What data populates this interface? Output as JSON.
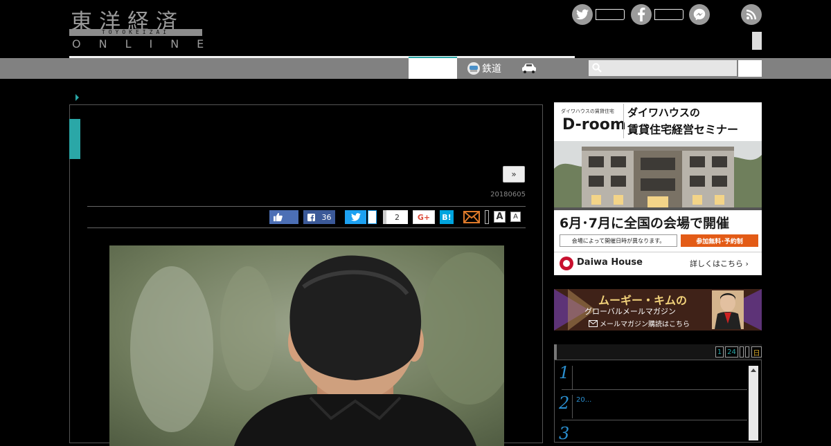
{
  "logo": {
    "kanji": "東洋経済",
    "romaji": "TOYOKEIZAI",
    "online": "ONLINE"
  },
  "header": {
    "social": [
      "twitter-icon",
      "facebook-icon",
      "messenger-icon",
      "rss-icon"
    ]
  },
  "nav": {
    "tetsudo_label": "鉄道",
    "search": {
      "placeholder": ""
    }
  },
  "article": {
    "next_button": "»",
    "date": "20180605",
    "share": {
      "facebook_count": "36",
      "pocket_count": "2",
      "gplus_label": "G+",
      "hatena_label": "B!",
      "font_large": "A",
      "font_small": "A"
    }
  },
  "sidebar": {
    "ad1": {
      "tagline": "ダイワハウスの賃貸住宅",
      "brand": "D-room",
      "headline_1": "ダイワハウスの",
      "headline_2": "賃貸住宅経営セミナー",
      "banner": "6月･7月に全国の会場で開催",
      "note": "会場によって開催日時が異なります。",
      "cta": "参加無料･予約制",
      "company": "Daiwa House",
      "more": "詳しくはこちら ›"
    },
    "ad2": {
      "title": "ムーギー・キムの",
      "subtitle": "グローバルメールマガジン",
      "cta": "メールマガジン購読はこちら"
    },
    "ranking": {
      "tabs": [
        "1",
        "24",
        "",
        "",
        "日"
      ],
      "items": [
        {
          "rank": "1",
          "text": ""
        },
        {
          "rank": "2",
          "text": "20..."
        },
        {
          "rank": "3",
          "text": ""
        }
      ]
    }
  },
  "colors": {
    "accent": "#2aa7a7",
    "nav_gray": "#818181",
    "background": "#000000"
  }
}
